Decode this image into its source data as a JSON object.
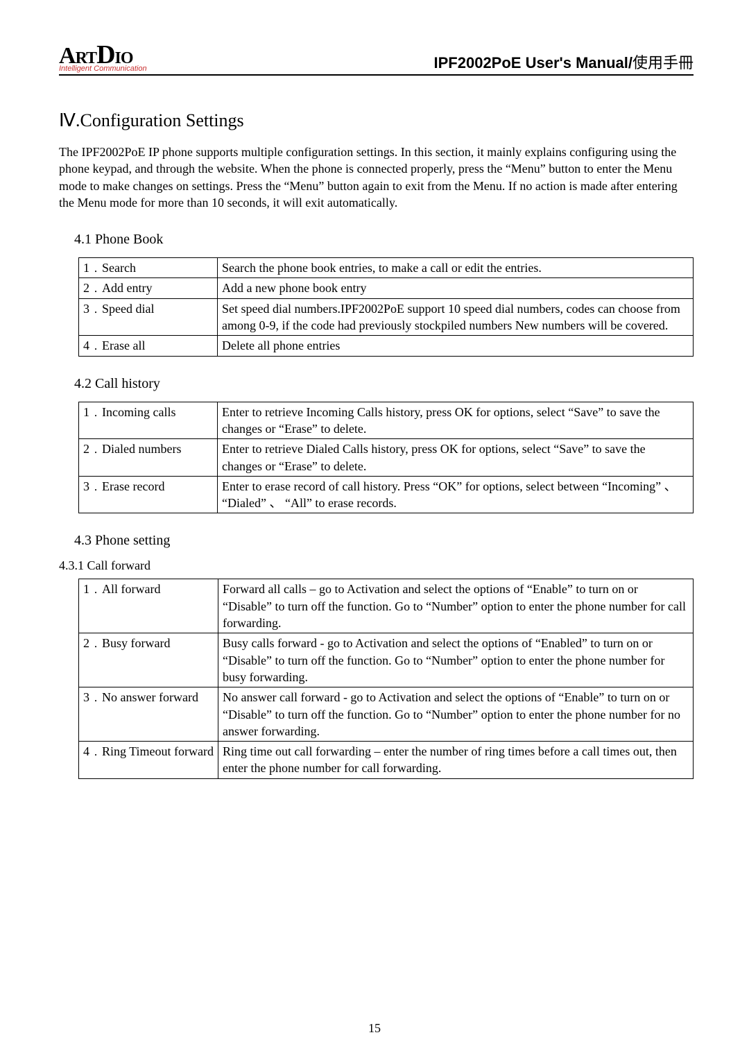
{
  "header": {
    "logo_main": "ArtDio",
    "logo_sub": "Intelligent Communication",
    "product_title_en": "IPF2002PoE User's Manual/",
    "product_title_cjk": "使用手冊"
  },
  "section": {
    "title": "Ⅳ.Configuration Settings",
    "intro": "The IPF2002PoE IP phone supports multiple configuration settings. In this section, it mainly explains configuring using the phone keypad, and through the website. When the phone is connected properly, press the “Menu” button to enter the Menu mode to make changes on settings. Press the “Menu” button again to exit from the Menu. If no action is made after entering the Menu mode for more than 10 seconds, it will exit automatically."
  },
  "phone_book": {
    "heading": "4.1 Phone Book",
    "rows": [
      {
        "label": "1﹒Search",
        "desc": "Search the phone book entries, to make a call or edit the entries."
      },
      {
        "label": "2﹒Add entry",
        "desc": "Add a new phone book entry"
      },
      {
        "label": "3﹒Speed dial",
        "desc": "Set speed dial numbers.IPF2002PoE support 10 speed dial numbers, codes can choose from among 0-9, if the code had previously stockpiled numbers New numbers will be covered."
      },
      {
        "label": "4﹒Erase all",
        "desc": "Delete all phone entries"
      }
    ]
  },
  "call_history": {
    "heading": "4.2 Call history",
    "rows": [
      {
        "label": "1﹒Incoming calls",
        "desc": "Enter to retrieve Incoming Calls history, press OK for options, select “Save” to save the changes or “Erase” to delete."
      },
      {
        "label": "2﹒Dialed numbers",
        "desc": "Enter to retrieve Dialed Calls history, press OK for options, select “Save” to save the changes or “Erase” to delete."
      },
      {
        "label": "3﹒Erase record",
        "desc": "Enter to erase record of call history. Press “OK” for options, select between “Incoming” 、 “Dialed” 、 “All” to erase records."
      }
    ]
  },
  "phone_setting": {
    "heading": "4.3 Phone setting",
    "call_forward": {
      "heading": "4.3.1 Call forward",
      "rows": [
        {
          "label": "1﹒All forward",
          "desc": "Forward all calls – go to Activation and select the options of “Enable” to turn on or “Disable” to turn off the function. Go to “Number” option to enter the phone number for call forwarding."
        },
        {
          "label": "2﹒Busy forward",
          "desc": "Busy calls forward - go to Activation and select the options of “Enabled” to turn on or “Disable” to turn off the function. Go to “Number” option to enter the phone number for busy forwarding."
        },
        {
          "label": "3﹒No answer forward",
          "desc": "No answer call forward - go to Activation and select the options of “Enable” to turn on or “Disable” to turn off the function. Go to “Number” option to enter the phone number for no answer forwarding."
        },
        {
          "label": "4﹒Ring Timeout forward",
          "desc": "Ring time out call forwarding – enter the number of ring times before a call times out, then enter the phone number for call forwarding."
        }
      ]
    }
  },
  "page_number": "15"
}
